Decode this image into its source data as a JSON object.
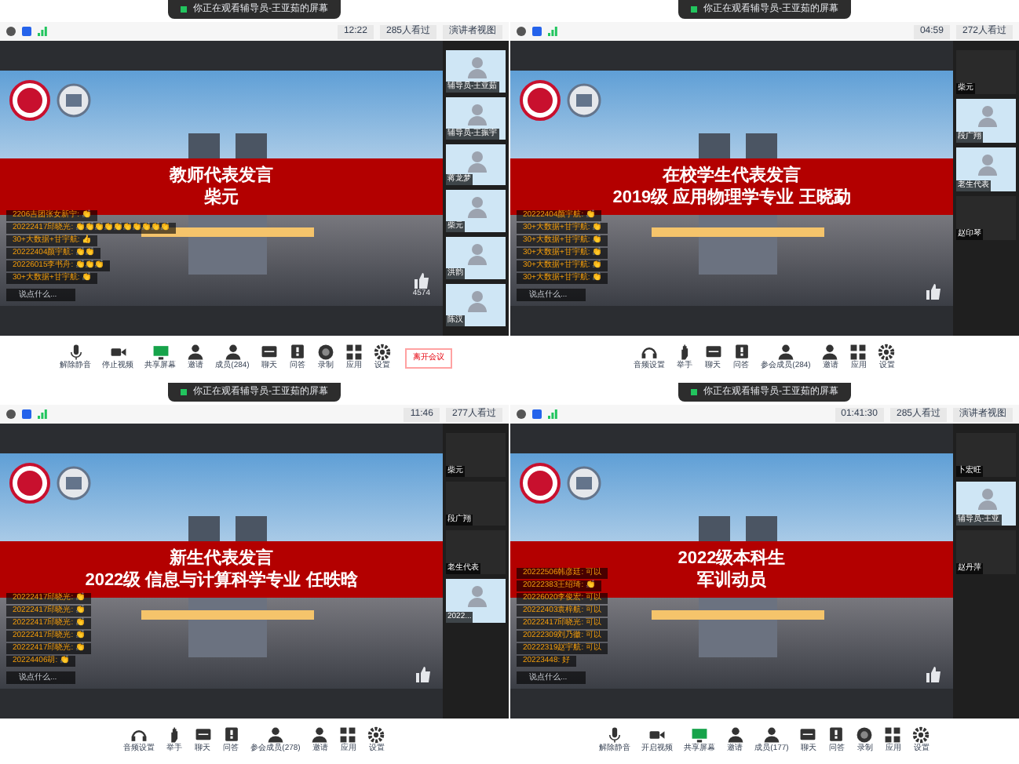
{
  "panels": [
    {
      "share_banner": "你正在观看辅导员-王亚茹的屏幕",
      "status": {
        "time": "12:22",
        "viewers": "285人看过",
        "view_mode": "演讲者视图"
      },
      "slide": {
        "lines": [
          "教师代表发言",
          "柴元"
        ]
      },
      "chat": [
        "2206吉团张女新宁: 👏",
        "20222417邱晓光: 👏👏👏👏👏👏👏👏👏👏",
        "30+大数据+甘宇航: 👍",
        "20222404颜宇航: 👏👏",
        "20226015李书舟: 👏👏👏",
        "30+大数据+甘宇航: 👏"
      ],
      "chat_input": "说点什么...",
      "like_count": "4574",
      "thumbnails": [
        {
          "name": "辅导员-王亚茹",
          "kind": "video"
        },
        {
          "name": "辅导员-王振宇",
          "kind": "video"
        },
        {
          "name": "蒋龙梦",
          "kind": "video"
        },
        {
          "name": "柴元",
          "kind": "video"
        },
        {
          "name": "洪韵",
          "kind": "video"
        },
        {
          "name": "陈汉",
          "kind": "video"
        }
      ],
      "toolbar": [
        {
          "label": "解除静音",
          "kind": "mic"
        },
        {
          "label": "停止视频",
          "kind": "camera"
        },
        {
          "label": "共享屏幕",
          "kind": "screen"
        },
        {
          "label": "邀请",
          "kind": "person"
        },
        {
          "label": "成员(284)",
          "kind": "person"
        },
        {
          "label": "聊天",
          "kind": "chat"
        },
        {
          "label": "问答",
          "kind": "question"
        },
        {
          "label": "录制",
          "kind": "record"
        },
        {
          "label": "应用",
          "kind": "apps"
        },
        {
          "label": "设置",
          "kind": "gear"
        }
      ],
      "leave_button": "离开会议"
    },
    {
      "share_banner": "你正在观看辅导员-王亚茹的屏幕",
      "status": {
        "time": "04:59",
        "viewers": "272人看过"
      },
      "slide": {
        "lines": [
          "在校学生代表发言",
          "2019级  应用物理学专业 王晓勐"
        ]
      },
      "chat": [
        "20222404颜宇航: 👏",
        "30+大数据+甘宇航: 👏",
        "30+大数据+甘宇航: 👏",
        "30+大数据+甘宇航: 👏",
        "30+大数据+甘宇航: 👏",
        "30+大数据+甘宇航: 👏"
      ],
      "chat_input": "说点什么...",
      "thumbnails": [
        {
          "name": "柴元",
          "kind": "camera_off"
        },
        {
          "name": "段广翔",
          "kind": "video"
        },
        {
          "name": "老生代表",
          "kind": "video"
        },
        {
          "name": "赵印琴",
          "kind": "camera_off"
        }
      ],
      "toolbar": [
        {
          "label": "音频设置",
          "kind": "headset"
        },
        {
          "label": "举手",
          "kind": "hand"
        },
        {
          "label": "聊天",
          "kind": "chat"
        },
        {
          "label": "问答",
          "kind": "question"
        },
        {
          "label": "参会成员(284)",
          "kind": "person"
        },
        {
          "label": "邀请",
          "kind": "person"
        },
        {
          "label": "应用",
          "kind": "apps"
        },
        {
          "label": "设置",
          "kind": "gear"
        }
      ]
    },
    {
      "share_banner": "你正在观看辅导员-王亚茹的屏幕",
      "status": {
        "time": "11:46",
        "viewers": "277人看过"
      },
      "slide": {
        "lines": [
          "新生代表发言",
          "2022级  信息与计算科学专业 任昳晗"
        ]
      },
      "chat": [
        "20222417邱晓光: 👏",
        "20222417邱晓光: 👏",
        "20222417邱晓光: 👏",
        "20222417邱晓光: 👏",
        "20222417邱晓光: 👏",
        "20224406胡: 👏"
      ],
      "chat_input": "说点什么...",
      "thumbnails": [
        {
          "name": "柴元",
          "kind": "camera_off"
        },
        {
          "name": "段广翔",
          "kind": "camera_off"
        },
        {
          "name": "老生代表",
          "kind": "camera_off"
        },
        {
          "name": "2022...",
          "kind": "video"
        }
      ],
      "toolbar": [
        {
          "label": "音频设置",
          "kind": "headset"
        },
        {
          "label": "举手",
          "kind": "hand"
        },
        {
          "label": "聊天",
          "kind": "chat"
        },
        {
          "label": "问答",
          "kind": "question"
        },
        {
          "label": "参会成员(278)",
          "kind": "person"
        },
        {
          "label": "邀请",
          "kind": "person"
        },
        {
          "label": "应用",
          "kind": "apps"
        },
        {
          "label": "设置",
          "kind": "gear"
        }
      ]
    },
    {
      "share_banner": "你正在观看辅导员-王亚茹的屏幕",
      "status": {
        "time": "01:41:30",
        "viewers": "285人看过",
        "view_mode": "演讲者视图"
      },
      "slide": {
        "lines": [
          "2022级本科生",
          "军训动员"
        ]
      },
      "chat": [
        "20222506韩彦廷: 可以",
        "20222383王绍琦: 👏",
        "20226020李俊宏: 可以",
        "20222403袁梓航: 可以",
        "20222417邱晓光: 可以",
        "20222309刘乃徽: 可以",
        "20222319赵宇航: 可以",
        "20223448: 好"
      ],
      "chat_input": "说点什么...",
      "thumbnails": [
        {
          "name": "卜宏旺",
          "kind": "camera_off"
        },
        {
          "name": "辅导员-王亚",
          "kind": "video"
        },
        {
          "name": "赵丹萍",
          "kind": "camera_off"
        }
      ],
      "toolbar": [
        {
          "label": "解除静音",
          "kind": "mic"
        },
        {
          "label": "开启视频",
          "kind": "camera"
        },
        {
          "label": "共享屏幕",
          "kind": "screen"
        },
        {
          "label": "邀请",
          "kind": "person"
        },
        {
          "label": "成员(177)",
          "kind": "person"
        },
        {
          "label": "聊天",
          "kind": "chat"
        },
        {
          "label": "问答",
          "kind": "question"
        },
        {
          "label": "录制",
          "kind": "record"
        },
        {
          "label": "应用",
          "kind": "apps"
        },
        {
          "label": "设置",
          "kind": "gear"
        }
      ]
    }
  ]
}
